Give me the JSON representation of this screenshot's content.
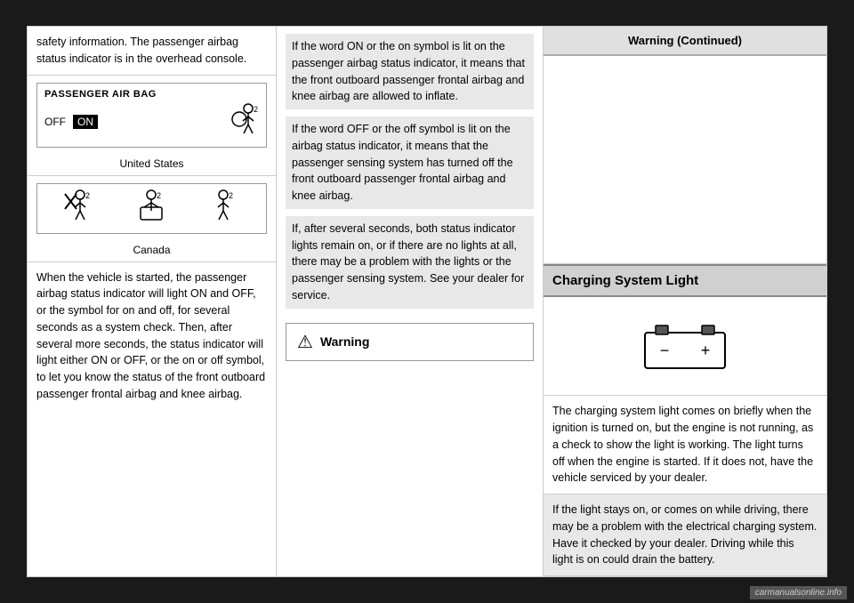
{
  "left": {
    "intro_text": "safety information. The passenger airbag status indicator is in the overhead console.",
    "airbag_label": "PASSENGER AIR BAG",
    "airbag_off": "OFF",
    "airbag_on": "ON",
    "airbag_icon": "🧍",
    "airbag_num": "2",
    "region_us": "United States",
    "canada_icons": [
      {
        "icon": "🚫🧍",
        "num": "2"
      },
      {
        "icon": "👶",
        "num": "2"
      },
      {
        "icon": "🧍",
        "num": "2"
      }
    ],
    "region_canada": "Canada",
    "vehicle_text": "When the vehicle is started, the passenger airbag status indicator will light ON and OFF, or the symbol for on and off, for several seconds as a system check. Then, after several more seconds, the status indicator will light either ON or OFF, or the on or off symbol, to let you know the status of the front outboard passenger frontal airbag and knee airbag."
  },
  "middle": {
    "para1": "If the word ON or the on symbol is lit on the passenger airbag status indicator, it means that the front outboard passenger frontal airbag and knee airbag are allowed to inflate.",
    "para2": "If the word OFF or the off symbol is lit on the airbag status indicator, it means that the passenger sensing system has turned off the front outboard passenger frontal airbag and knee airbag.",
    "para3": "If, after several seconds, both status indicator lights remain on, or if there are no lights at all, there may be a problem with the lights or the passenger sensing system. See your dealer for service.",
    "warning_label": "Warning"
  },
  "right": {
    "continued_label": "Warning  (Continued)",
    "charging_header": "Charging System Light",
    "battery_minus": "−",
    "battery_plus": "+",
    "charging_text1": "The charging system light comes on briefly when the ignition is turned on, but the engine is not running, as a check to show the light is working. The light turns off when the engine is started. If it does not, have the vehicle serviced by your dealer.",
    "charging_text2": "If the light stays on, or comes on while driving, there may be a problem with the electrical charging system. Have it checked by your dealer. Driving while this light is on could drain the battery."
  },
  "watermark": "carmanualsonline.info"
}
